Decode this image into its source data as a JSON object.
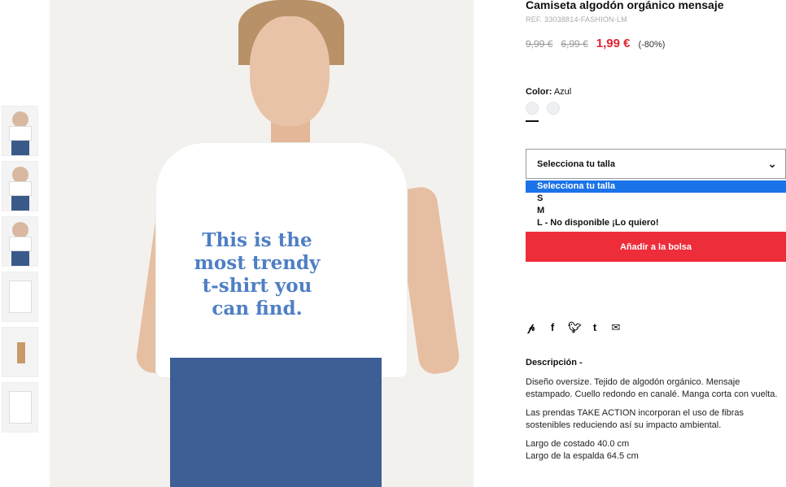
{
  "product": {
    "title": "Camiseta algodón orgánico mensaje",
    "ref": "REF. 33038814-FASHION-LM",
    "price_original": "9,99 €",
    "price_previous": "6,99 €",
    "price_current": "1,99 €",
    "discount": "(-80%)",
    "shirt_print": "This is the\nmost trendy\nt-shirt you\ncan find.",
    "color_label": "Color:",
    "color_value": "Azul"
  },
  "size_select": {
    "placeholder": "Selecciona tu talla",
    "options": [
      "Selecciona tu talla",
      "S",
      "M",
      "L - No disponible ¡Lo quiero!"
    ]
  },
  "actions": {
    "add_to_bag": "Añadir a la bolsa"
  },
  "social_icons": [
    "pinterest-icon",
    "facebook-icon",
    "twitter-icon",
    "tumblr-icon",
    "email-icon"
  ],
  "description": {
    "heading": "Descripción -",
    "paragraph_1": "Diseño oversize. Tejido de algodón orgánico. Mensaje estampado. Cuello redondo en canalé. Manga corta con vuelta.",
    "paragraph_2": "Las prendas TAKE ACTION incorporan el uso de fibras sostenibles reduciendo así su impacto ambiental.",
    "measure_1": "Largo de costado 40.0 cm",
    "measure_2": "Largo de la espalda 64.5 cm"
  },
  "colors": {
    "accent": "#ee2d3b",
    "price": "#e3222f",
    "selection": "#1a73e8",
    "print": "#4f7fc4"
  }
}
